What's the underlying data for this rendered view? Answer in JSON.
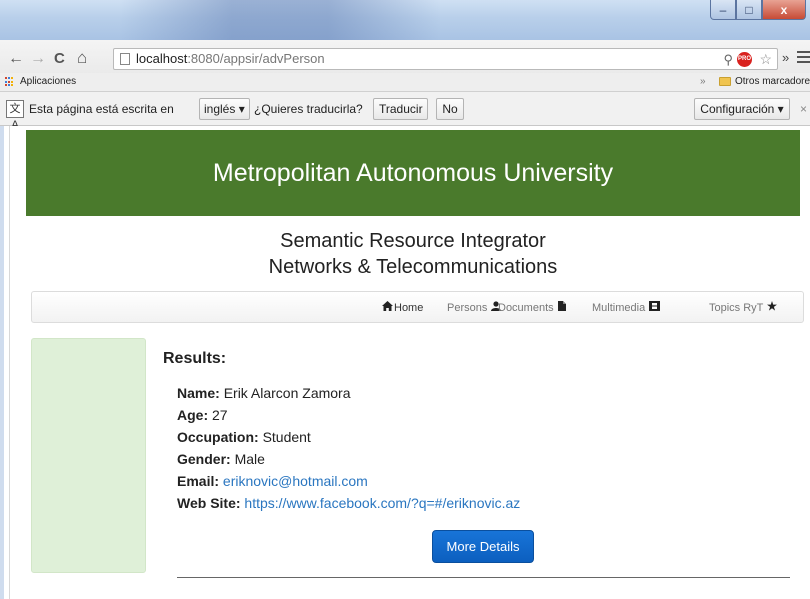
{
  "window": {
    "controls": {
      "minimize": "–",
      "maximize": "□",
      "close": "x"
    }
  },
  "browser": {
    "nav": {
      "back": "←",
      "forward": "→",
      "reload": "C",
      "home": "⌂"
    },
    "address": {
      "host": "localhost",
      "path": ":8080/appsir/advPerson"
    },
    "zoom_glyph": "⚲",
    "extension_badge": "PRO",
    "star_glyph": "☆",
    "extensions_more": "»",
    "bookmarks": {
      "apps_label": "Aplicaciones",
      "overflow": "»",
      "others_label": "Otros marcadores"
    },
    "translate": {
      "icon_glyph": "文A",
      "text_before": "Esta página está escrita en",
      "language": "inglés ▾",
      "question": "¿Quieres traducirla?",
      "translate_button": "Traducir",
      "no_button": "No",
      "settings_button": "Configuración ▾",
      "close": "×"
    }
  },
  "page": {
    "banner_title": "Metropolitan Autonomous University",
    "subtitle_line1": "Semantic Resource Integrator",
    "subtitle_line2": "Networks & Telecommunications",
    "nav": {
      "home": "Home",
      "persons": "Persons",
      "documents": "Documents",
      "multimedia": "Multimedia",
      "topics": "Topics RyT"
    },
    "nav_icons": {
      "home": "house-icon",
      "persons": "user-icon",
      "documents": "file-icon",
      "multimedia": "film-icon",
      "topics": "star-icon"
    },
    "results_title": "Results:",
    "person": {
      "name_label": "Name:",
      "name_value": "Erik Alarcon Zamora",
      "age_label": "Age:",
      "age_value": "27",
      "occupation_label": "Occupation:",
      "occupation_value": "Student",
      "gender_label": "Gender:",
      "gender_value": "Male",
      "email_label": "Email:",
      "email_value": "eriknovic@hotmail.com",
      "website_label": "Web Site:",
      "website_value": "https://www.facebook.com/?q=#/eriknovic.az"
    },
    "more_details_button": "More Details"
  },
  "colors": {
    "banner_green": "#4a7a2c",
    "side_panel_green": "#dff0d8",
    "link_blue": "#2a76c0",
    "button_blue": "#1874d8"
  }
}
